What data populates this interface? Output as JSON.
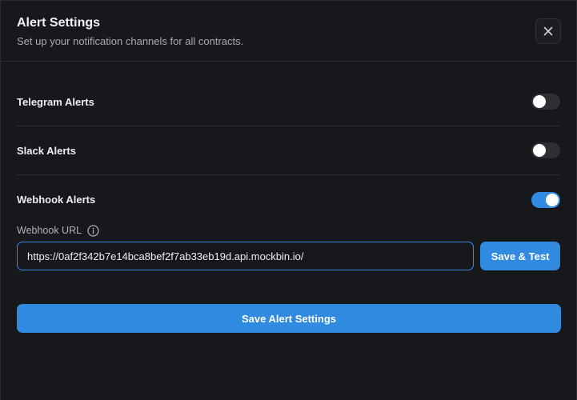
{
  "dialog": {
    "title": "Alert Settings",
    "subtitle": "Set up your notification channels for all contracts.",
    "close_icon": "close-icon"
  },
  "alerts": [
    {
      "label": "Telegram Alerts",
      "enabled": false
    },
    {
      "label": "Slack Alerts",
      "enabled": false
    },
    {
      "label": "Webhook Alerts",
      "enabled": true
    }
  ],
  "webhook": {
    "url_label": "Webhook URL",
    "info_icon": "info-icon",
    "url_value": "https://0af2f342b7e14bca8bef2f7ab33eb19d.api.mockbin.io/",
    "save_test_label": "Save & Test"
  },
  "footer": {
    "save_label": "Save Alert Settings"
  },
  "colors": {
    "background": "#17181c",
    "accent": "#2f8ae0",
    "toggle_off": "#2d2f34"
  }
}
